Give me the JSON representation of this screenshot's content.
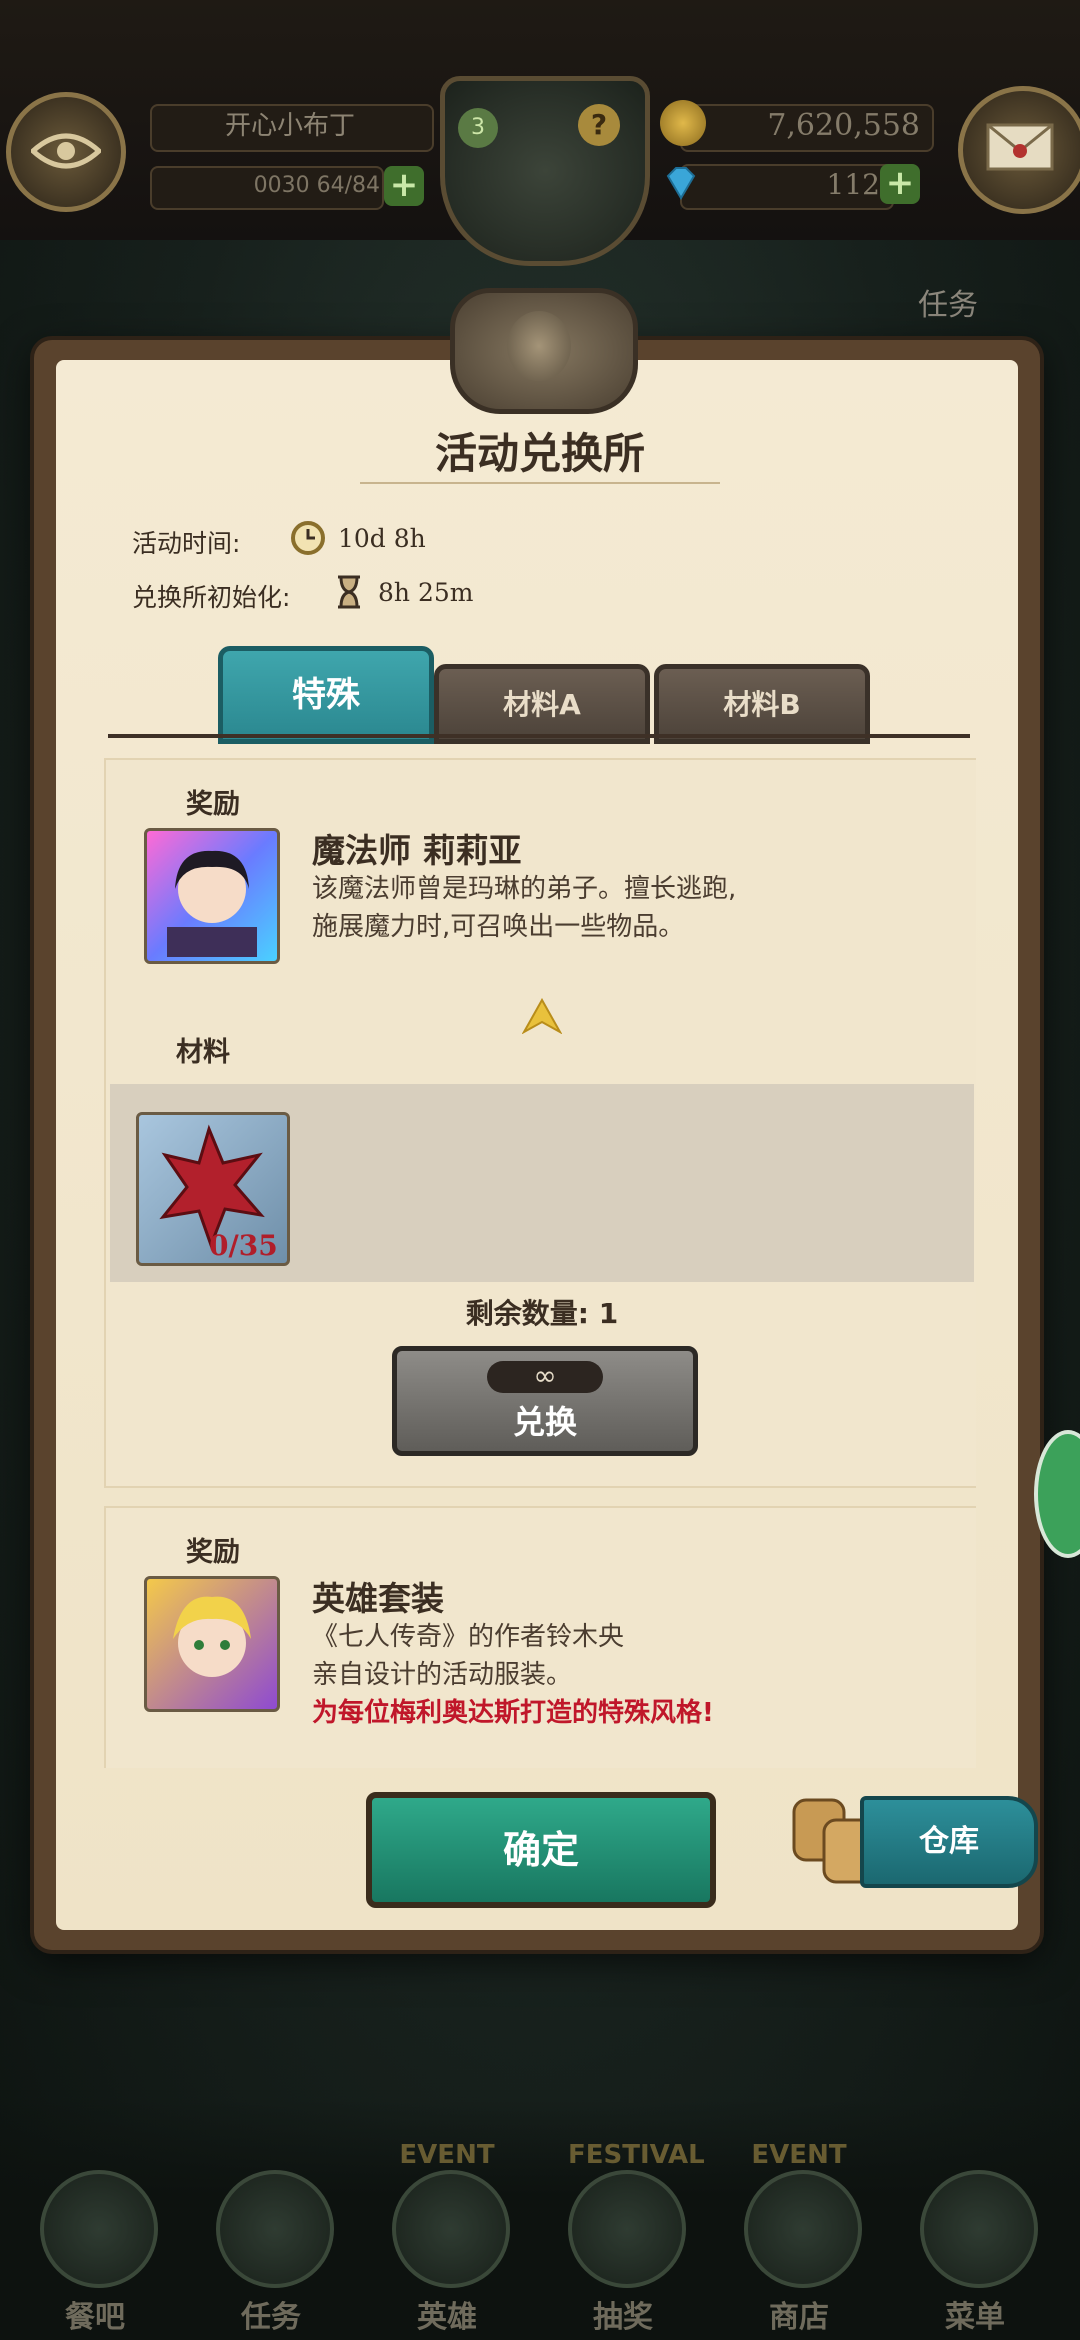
{
  "hud": {
    "player_name": "开心小布丁",
    "stamina": "0030 64/84",
    "level_badge": "3",
    "help": "?",
    "gold": "7,620,558",
    "gems": "112",
    "quest_label": "任务"
  },
  "dialog": {
    "title": "活动兑换所",
    "event_time_label": "活动时间:",
    "event_time_value": "10d 8h",
    "reset_label": "兑换所初始化:",
    "reset_value": "8h 25m",
    "tabs": [
      {
        "label": "特殊"
      },
      {
        "label": "材料A"
      },
      {
        "label": "材料B"
      }
    ],
    "items": [
      {
        "reward_label": "奖励",
        "name": "魔法师 莉莉亚",
        "desc_1": "该魔法师曾是玛琳的弟子。擅长逃跑,",
        "desc_2": "施展魔力时,可召唤出一些物品。",
        "material_label": "材料",
        "material_count": "0/35",
        "remaining": "剩余数量: 1",
        "limit": "∞",
        "exchange": "兑换"
      },
      {
        "reward_label": "奖励",
        "name": "英雄套装",
        "desc_1": "《七人传奇》的作者铃木央",
        "desc_2": "亲自设计的活动服装。",
        "desc_3": "为每位梅利奥达斯打造的特殊风格!"
      }
    ],
    "confirm": "确定",
    "storage": "仓库"
  },
  "nav": [
    {
      "label": "餐吧"
    },
    {
      "label": "任务"
    },
    {
      "label": "英雄",
      "badge": "EVENT"
    },
    {
      "label": "抽奖",
      "badge": "FESTIVAL"
    },
    {
      "label": "商店",
      "badge": "EVENT"
    },
    {
      "label": "菜单"
    }
  ],
  "colors": {
    "accent": "#2b8890",
    "confirm": "#1f8d72",
    "alert_text": "#c0172a"
  }
}
